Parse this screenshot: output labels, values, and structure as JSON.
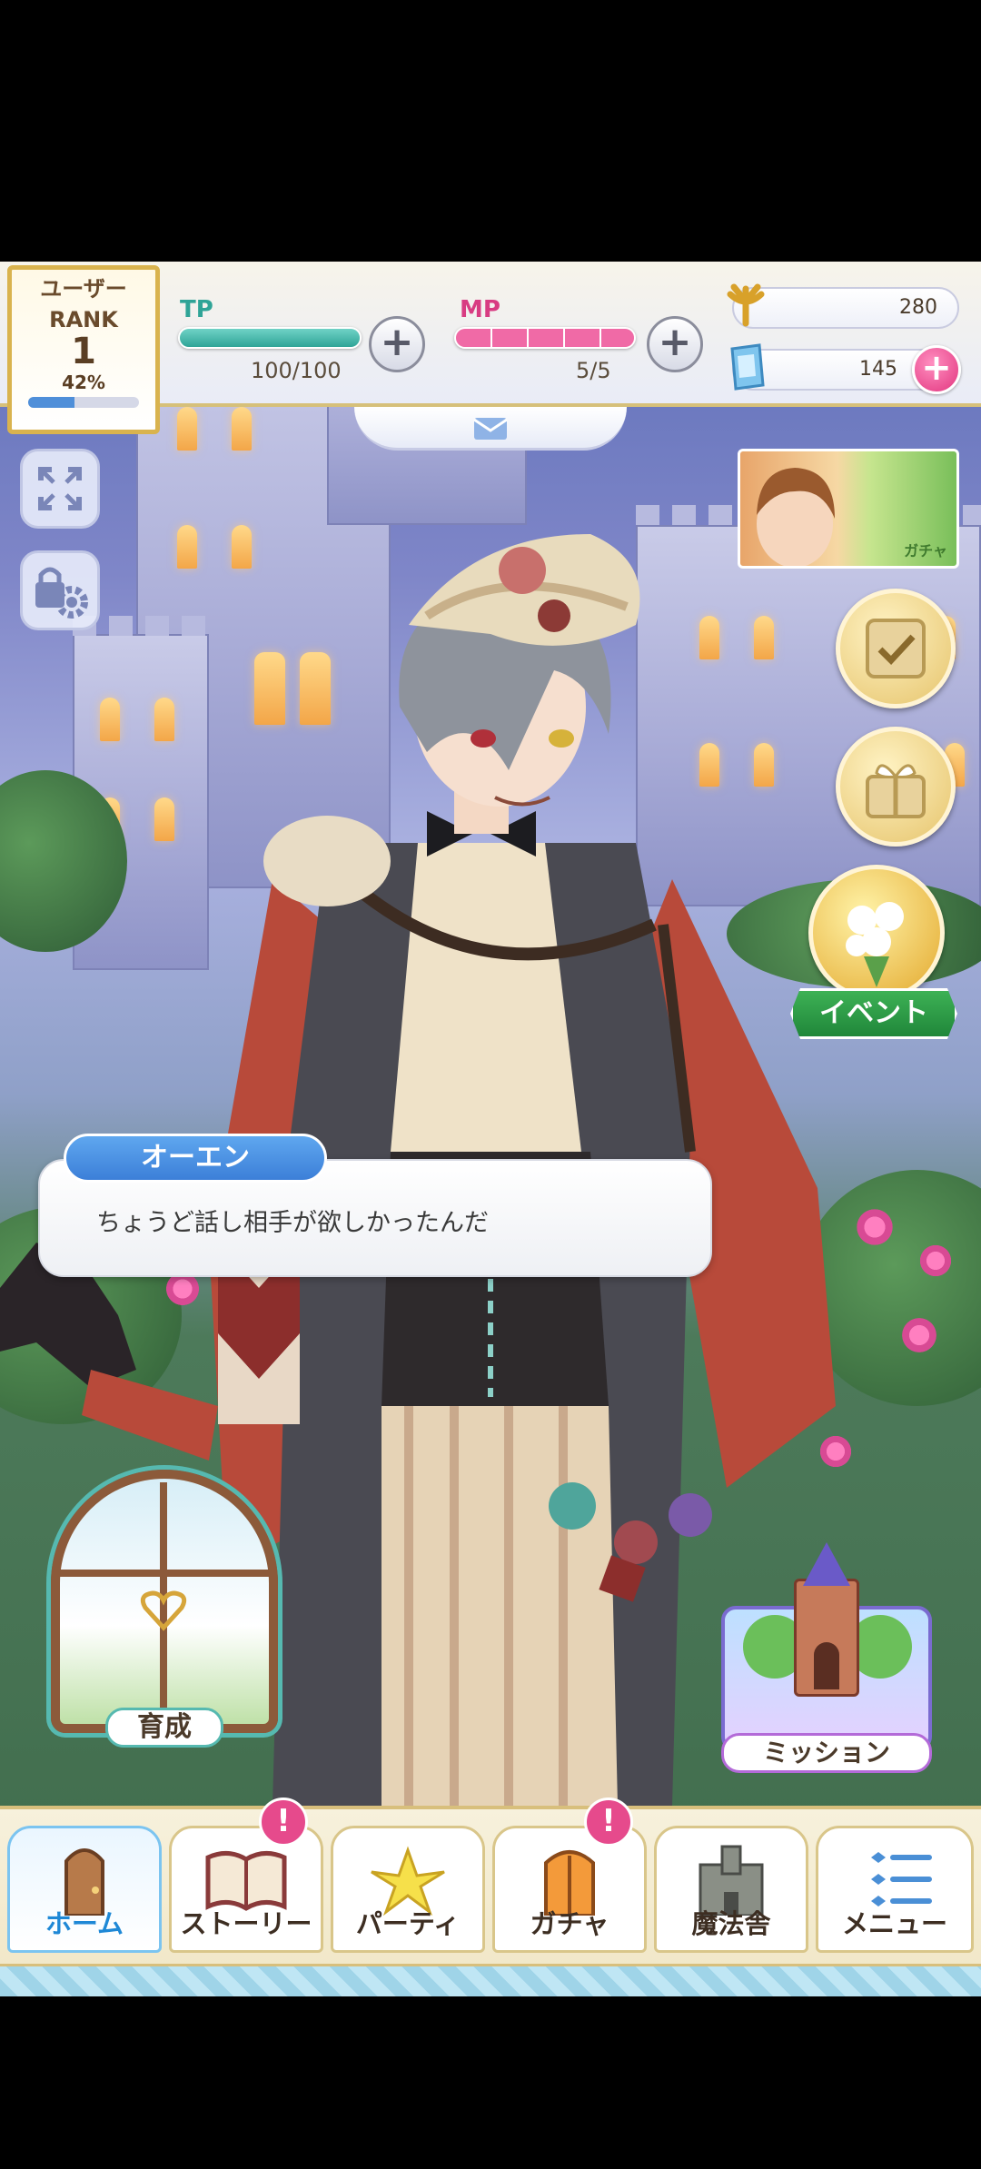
{
  "rank": {
    "title_line1": "ユーザー",
    "title_line2": "RANK",
    "level": "1",
    "progress_text": "42%",
    "progress_fraction": 0.42
  },
  "tp": {
    "label": "TP",
    "value": "100/100",
    "fraction": 1.0
  },
  "mp": {
    "label": "MP",
    "value": "5/5",
    "fraction": 1.0
  },
  "currency": {
    "gold": "280",
    "stones": "145"
  },
  "dialogue": {
    "speaker": "オーエン",
    "text": "ちょうど話し相手が欲しかったんだ"
  },
  "banner": {
    "label": "ガチャ"
  },
  "event_button": {
    "label": "イベント"
  },
  "training": {
    "label": "育成"
  },
  "mission": {
    "label": "ミッション"
  },
  "nav": {
    "items": [
      {
        "label": "ホーム",
        "icon": "door-icon",
        "active": true,
        "alert": false
      },
      {
        "label": "ストーリー",
        "icon": "book-icon",
        "active": false,
        "alert": true
      },
      {
        "label": "パーティ",
        "icon": "lily-icon",
        "active": false,
        "alert": false
      },
      {
        "label": "ガチャ",
        "icon": "gate-icon",
        "active": false,
        "alert": true
      },
      {
        "label": "魔法舎",
        "icon": "castle-icon",
        "active": false,
        "alert": false
      },
      {
        "label": "メニュー",
        "icon": "list-icon",
        "active": false,
        "alert": false
      }
    ],
    "alert_mark": "!"
  },
  "colors": {
    "tp": "#3fb3a6",
    "mp": "#e24a8e",
    "accent": "#d9b34e",
    "active_nav": "#1e88d6"
  }
}
